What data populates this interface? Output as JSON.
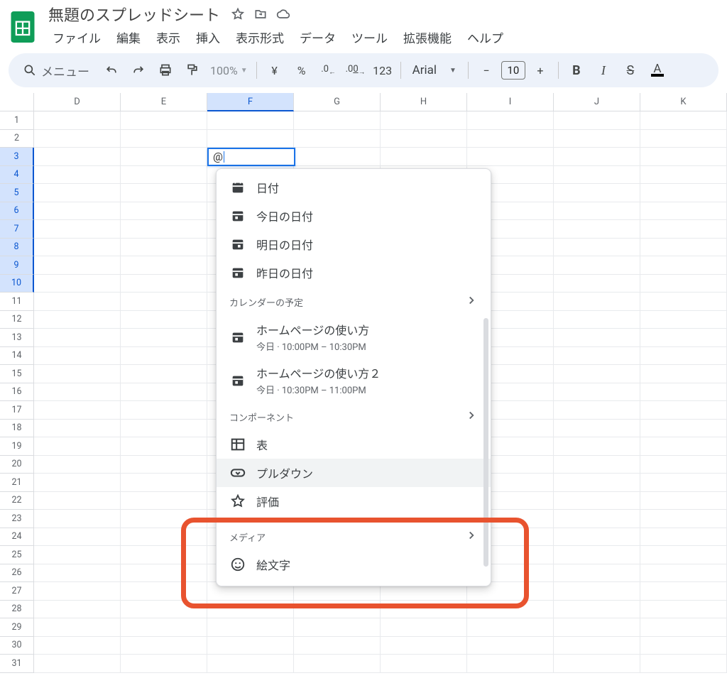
{
  "doc": {
    "title": "無題のスプレッドシート"
  },
  "menus": [
    "ファイル",
    "編集",
    "表示",
    "挿入",
    "表示形式",
    "データ",
    "ツール",
    "拡張機能",
    "ヘルプ"
  ],
  "toolbar": {
    "search_placeholder": "メニュー",
    "zoom": "100%",
    "currency": "¥",
    "percent": "%",
    "dec_dec": ".0",
    "dec_inc": ".00",
    "numfmt": "123",
    "font": "Arial",
    "font_size": "10"
  },
  "columns": [
    "D",
    "E",
    "F",
    "G",
    "H",
    "I",
    "J",
    "K"
  ],
  "selected_col_index": 2,
  "row_count": 31,
  "selected_rows_start": 3,
  "selected_rows_end": 10,
  "active_cell_value": "@",
  "suggest": {
    "dates": [
      {
        "label": "日付"
      },
      {
        "label": "今日の日付"
      },
      {
        "label": "明日の日付"
      },
      {
        "label": "昨日の日付"
      }
    ],
    "sec_calendar": "カレンダーの予定",
    "events": [
      {
        "title": "ホームページの使い方",
        "sub": "今日 · 10:00PM – 10:30PM"
      },
      {
        "title": "ホームページの使い方２",
        "sub": "今日 · 10:30PM – 11:00PM"
      }
    ],
    "sec_components": "コンポーネント",
    "components": [
      {
        "label": "表"
      },
      {
        "label": "プルダウン"
      },
      {
        "label": "評価"
      }
    ],
    "sec_media": "メディア",
    "media": [
      {
        "label": "絵文字"
      }
    ]
  }
}
